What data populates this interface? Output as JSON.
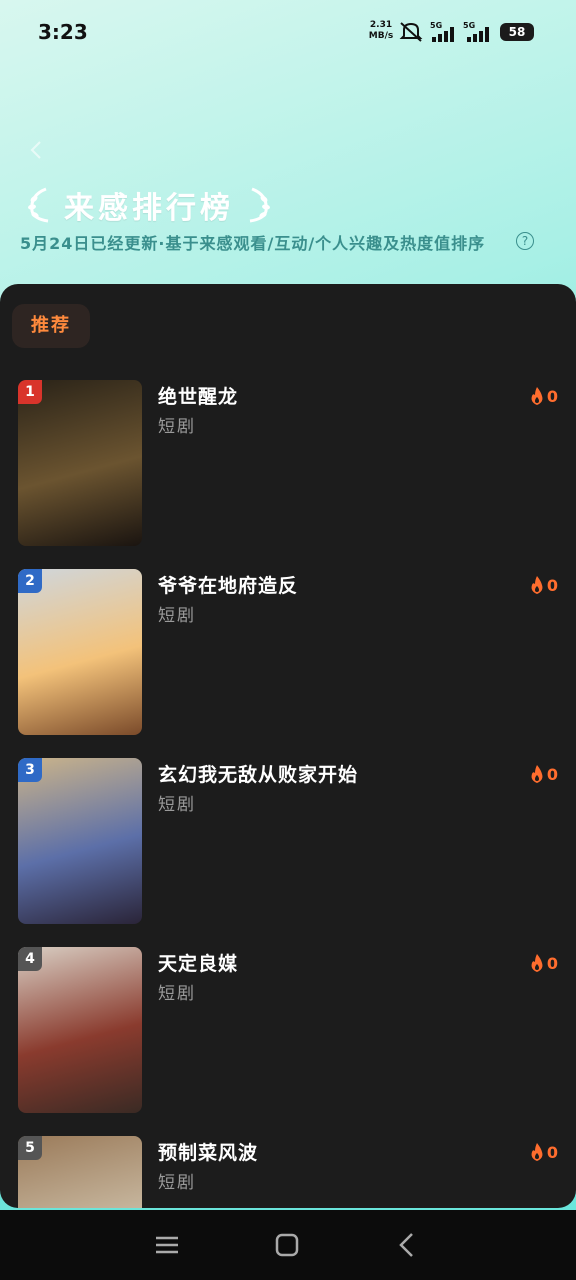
{
  "status_bar": {
    "time": "3:23",
    "net_speed_value": "2.31",
    "net_speed_unit": "MB/s",
    "signal_1_label": "5G",
    "signal_2_label": "5G",
    "battery": "58"
  },
  "header": {
    "title": "来感排行榜",
    "subtitle": "5月24日已经更新·基于来感观看/互动/个人兴趣及热度值排序"
  },
  "tabs": [
    {
      "label": "推荐",
      "active": true
    }
  ],
  "ranking": [
    {
      "rank": "1",
      "title": "绝世醒龙",
      "genre": "短剧",
      "heat": "0",
      "rank_color": "#d9342b",
      "cover_colors": [
        "#2a2318",
        "#6b5430",
        "#1a1410"
      ]
    },
    {
      "rank": "2",
      "title": "爷爷在地府造反",
      "genre": "短剧",
      "heat": "0",
      "rank_color": "#2f6ac6",
      "cover_colors": [
        "#cfd6dc",
        "#f3c27a",
        "#7a4a2a"
      ]
    },
    {
      "rank": "3",
      "title": "玄幻我无敌从败家开始",
      "genre": "短剧",
      "heat": "0",
      "rank_color": "#2f6ac6",
      "cover_colors": [
        "#cbb48a",
        "#5c6fa8",
        "#2a2438"
      ]
    },
    {
      "rank": "4",
      "title": "天定良媒",
      "genre": "短剧",
      "heat": "0",
      "rank_color": "#555555",
      "cover_colors": [
        "#d9cfc4",
        "#8a3b2e",
        "#3a2a24"
      ]
    },
    {
      "rank": "5",
      "title": "预制菜风波",
      "genre": "短剧",
      "heat": "0",
      "rank_color": "#555555",
      "cover_colors": [
        "#9b7b5a",
        "#c8b8a0",
        "#4a3a2e"
      ]
    }
  ],
  "colors": {
    "accent": "#ff6d2e",
    "panel": "#1c1c1c"
  },
  "icons": [
    "mute-icon",
    "signal-icon",
    "battery-icon",
    "back-icon",
    "laurel-icon",
    "help-icon",
    "fire-icon",
    "menu-icon",
    "home-icon",
    "nav-back-icon"
  ]
}
